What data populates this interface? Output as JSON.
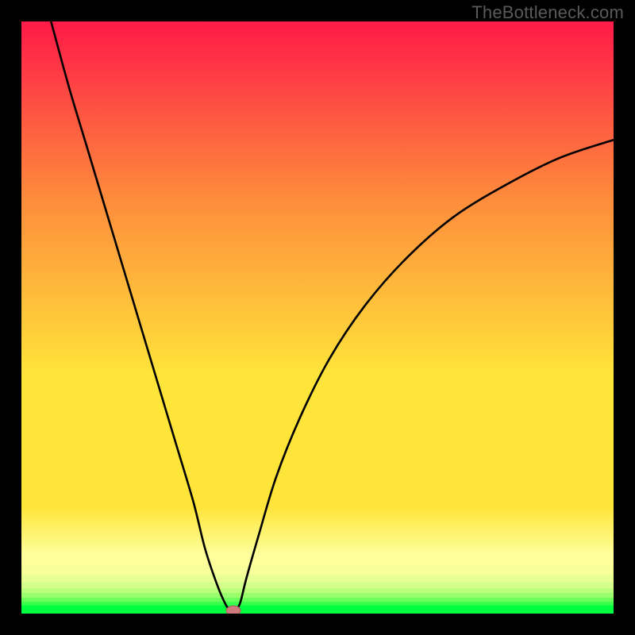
{
  "attribution": "TheBottleneck.com",
  "colors": {
    "frame": "#000000",
    "top": "#fe1a48",
    "mid_orange": "#fe8c3c",
    "yellow": "#ffe53a",
    "pale_yellow": "#feff9b",
    "pale_green": "#bcff7c",
    "green": "#00ff3f",
    "curve": "#000000",
    "marker_fill": "#cf7a7c",
    "marker_stroke": "#b55e63"
  },
  "chart_data": {
    "type": "line",
    "title": "",
    "xlabel": "",
    "ylabel": "",
    "xlim": [
      0,
      100
    ],
    "ylim": [
      0,
      100
    ],
    "series": [
      {
        "name": "left-branch",
        "x": [
          5,
          8,
          11,
          14,
          17,
          20,
          23,
          26,
          29,
          31,
          33,
          34.5,
          35.3
        ],
        "y": [
          100,
          89,
          79,
          69,
          59,
          49,
          39,
          29,
          19,
          11,
          5,
          1.5,
          0.5
        ]
      },
      {
        "name": "right-branch",
        "x": [
          36.3,
          37,
          38,
          40,
          43,
          47,
          52,
          58,
          65,
          73,
          82,
          91,
          100
        ],
        "y": [
          0.5,
          2,
          6,
          13,
          23,
          33,
          43,
          52,
          60,
          67,
          72.5,
          77,
          80
        ]
      }
    ],
    "marker": {
      "x": 35.8,
      "y": 0.5,
      "rx": 1.2,
      "ry": 0.8
    },
    "bottom_bands": [
      {
        "y0": 90.5,
        "y1": 92.0,
        "color": "#feff9b"
      },
      {
        "y0": 92.0,
        "y1": 93.5,
        "color": "#f6ff9a"
      },
      {
        "y0": 93.5,
        "y1": 94.7,
        "color": "#e7ff94"
      },
      {
        "y0": 94.7,
        "y1": 95.7,
        "color": "#d5ff8c"
      },
      {
        "y0": 95.7,
        "y1": 96.5,
        "color": "#bcff7c"
      },
      {
        "y0": 96.5,
        "y1": 97.3,
        "color": "#9aff6c"
      },
      {
        "y0": 97.3,
        "y1": 98.0,
        "color": "#6aff5a"
      },
      {
        "y0": 98.0,
        "y1": 98.6,
        "color": "#38ff4c"
      },
      {
        "y0": 98.6,
        "y1": 100,
        "color": "#00ff3f"
      }
    ]
  }
}
